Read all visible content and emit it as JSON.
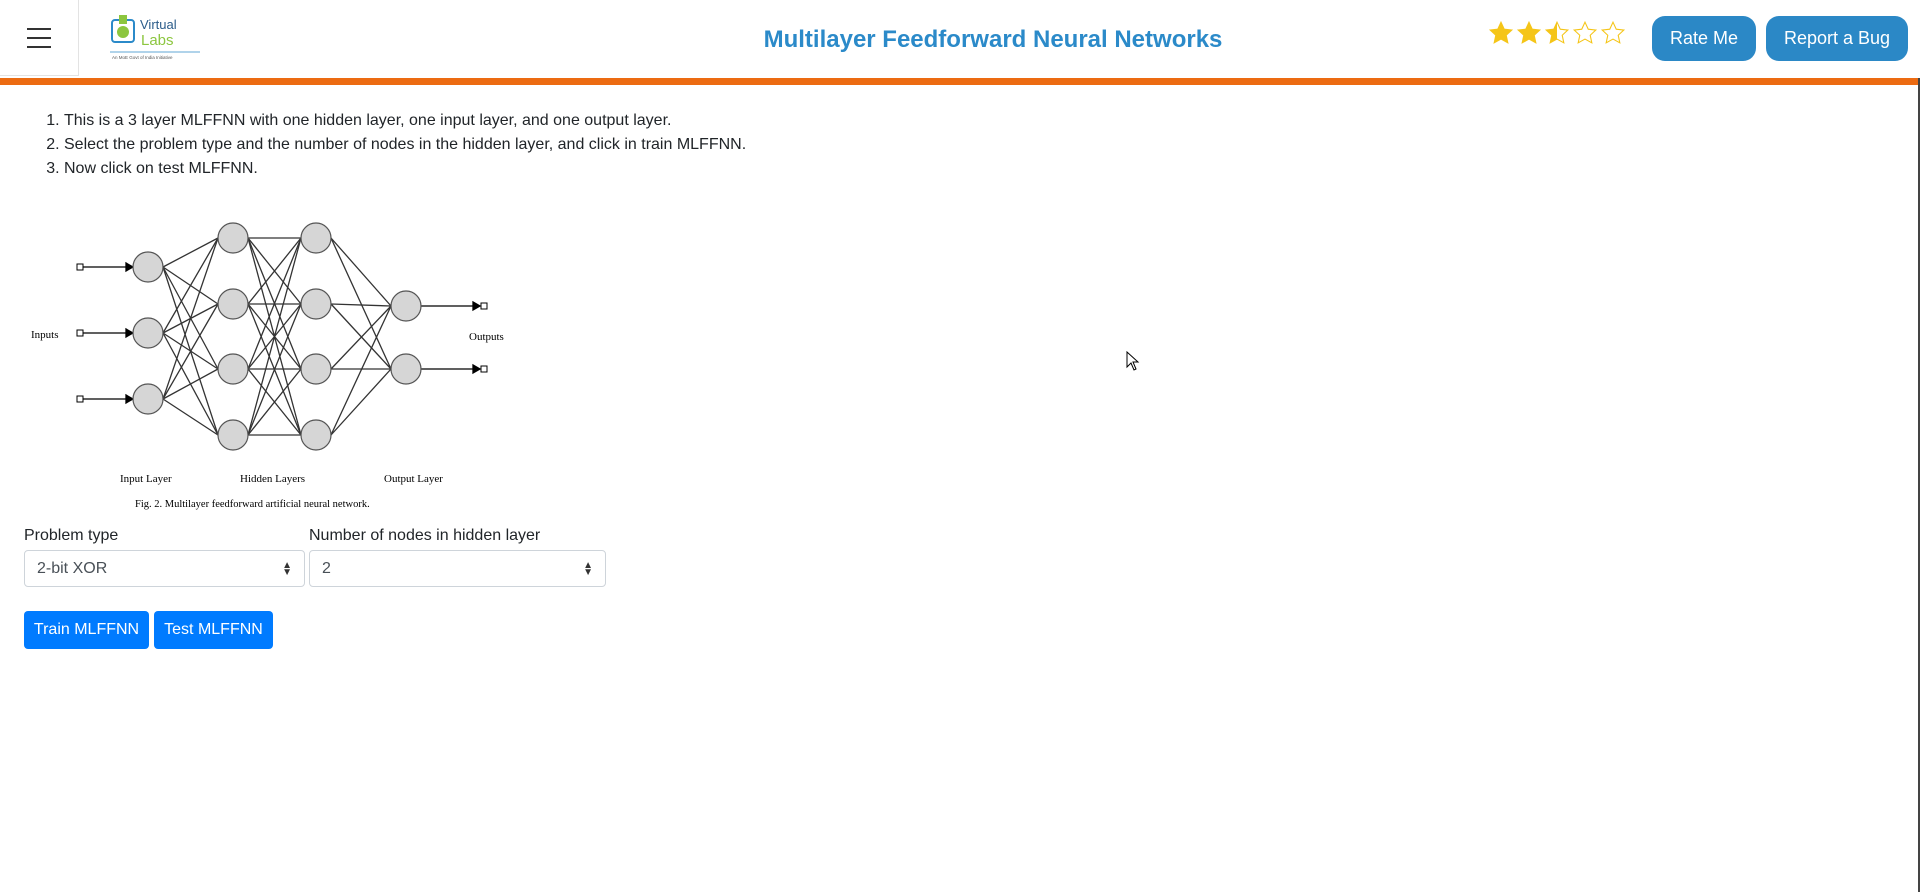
{
  "header": {
    "title": "Multilayer Feedforward Neural Networks",
    "logo_text_1": "Virtual",
    "logo_text_2": "Labs",
    "logo_tagline": "An MoE Govt of India Initiative",
    "rating": {
      "value": 2.5,
      "max": 5,
      "color": "#f5c518"
    },
    "rate_button": "Rate Me",
    "bug_button": "Report a Bug"
  },
  "instructions": [
    "This is a 3 layer MLFFNN with one hidden layer, one input layer, and one output layer.",
    "Select the problem type and the number of nodes in the hidden layer, and click in train MLFFNN.",
    "Now click on test MLFFNN."
  ],
  "figure": {
    "inputs_label": "Inputs",
    "outputs_label": "Outputs",
    "input_layer_label": "Input Layer",
    "hidden_layers_label": "Hidden Layers",
    "output_layer_label": "Output Layer",
    "caption": "Fig. 2. Multilayer feedforward artificial neural network."
  },
  "form": {
    "problem_type_label": "Problem type",
    "problem_type_value": "2-bit XOR",
    "nodes_label": "Number of nodes in hidden layer",
    "nodes_value": "2",
    "train_button": "Train MLFFNN",
    "test_button": "Test MLFFNN"
  },
  "colors": {
    "accent": "#2b8ac9",
    "header_rule": "#ec6b12",
    "button": "#007bff"
  }
}
